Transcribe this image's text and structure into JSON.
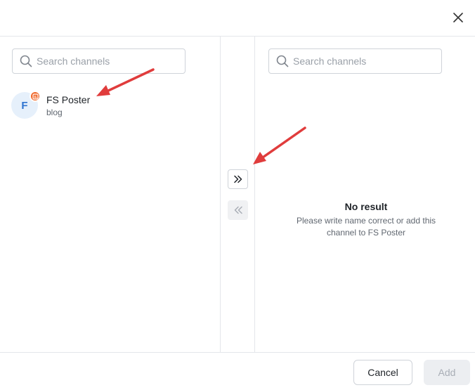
{
  "colors": {
    "accent": "#2f74d0",
    "badge": "#f0682a",
    "annotation_arrow": "#e03c3c",
    "border": "#e4e6ea"
  },
  "header": {
    "close_icon": "close-icon"
  },
  "left_panel": {
    "search": {
      "placeholder": "Search channels",
      "value": ""
    },
    "channels": [
      {
        "avatar_letter": "F",
        "name": "FS Poster",
        "type": "blog",
        "badge_icon": "blogger-icon"
      }
    ]
  },
  "transfer": {
    "move_right_icon": "chevrons-right-icon",
    "move_left_icon": "chevrons-left-icon"
  },
  "right_panel": {
    "search": {
      "placeholder": "Search channels",
      "value": ""
    },
    "empty": {
      "title": "No result",
      "description": "Please write name correct or add this channel to FS Poster"
    }
  },
  "footer": {
    "cancel_label": "Cancel",
    "add_label": "Add"
  }
}
